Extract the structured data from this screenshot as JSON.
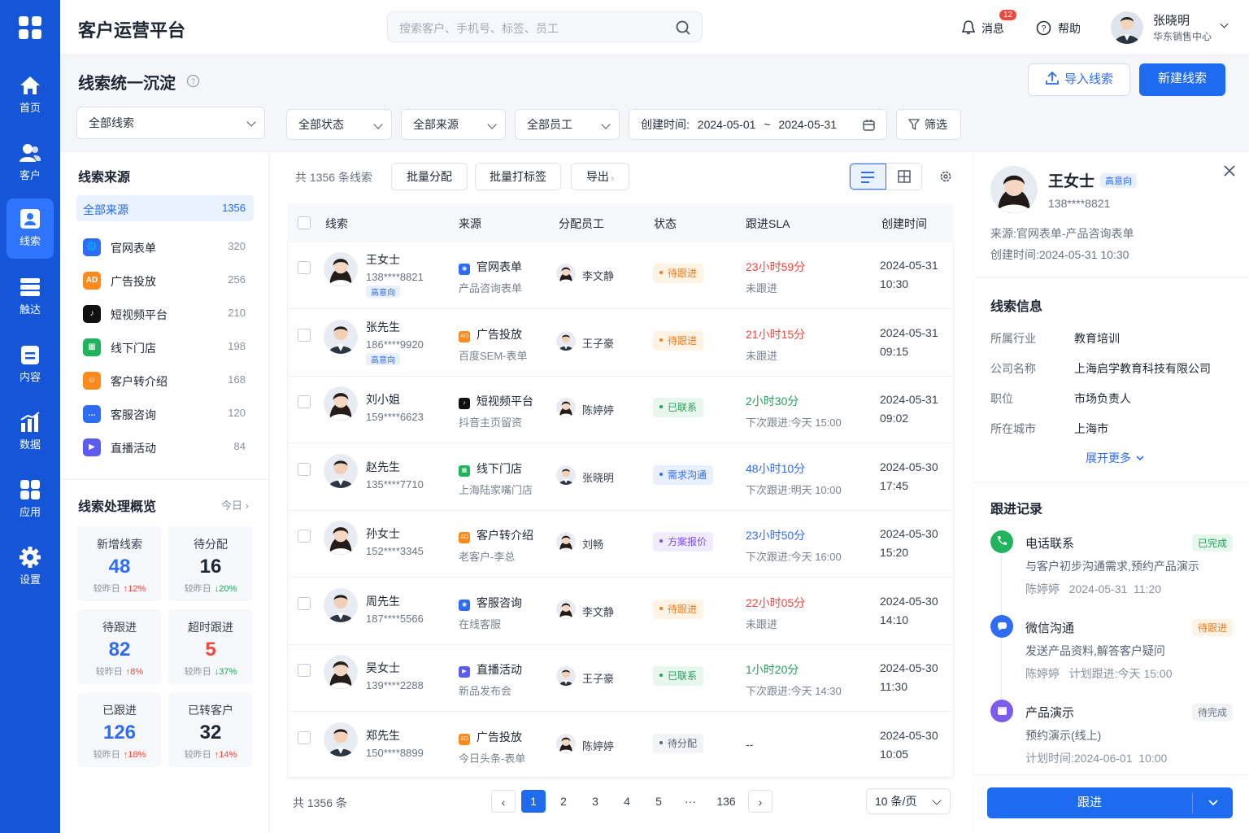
{
  "nav": {
    "items": [
      {
        "label": "首页"
      },
      {
        "label": "客户"
      },
      {
        "label": "线索"
      },
      {
        "label": "触达"
      },
      {
        "label": "内容"
      },
      {
        "label": "数据"
      },
      {
        "label": "应用"
      },
      {
        "label": "设置"
      }
    ]
  },
  "header": {
    "app_title": "客户运营平台",
    "search_placeholder": "搜索客户、手机号、标签、员工",
    "messages_label": "消息",
    "messages_count": "12",
    "help_label": "帮助",
    "user_name": "张晓明",
    "user_dept": "华东销售中心"
  },
  "page": {
    "title": "线索统一沉淀",
    "import_label": "导入线索",
    "new_label": "新建线索"
  },
  "filters": {
    "scope": "全部线索",
    "status": "全部状态",
    "source": "全部来源",
    "staff": "全部员工",
    "date_label": "创建时间:",
    "date_start": "2024-05-01",
    "date_sep": "~",
    "date_end": "2024-05-31",
    "filter_label": "筛选"
  },
  "sources": {
    "title": "线索来源",
    "all_label": "全部来源",
    "all_count": "1356",
    "items": [
      {
        "label": "官网表单",
        "count": "320",
        "icon": "globe-icon",
        "color": "#2f6cf5"
      },
      {
        "label": "广告投放",
        "count": "256",
        "icon": "ad-icon",
        "color": "#ff8a1f"
      },
      {
        "label": "短视频平台",
        "count": "210",
        "icon": "tiktok-icon",
        "color": "#111111"
      },
      {
        "label": "线下门店",
        "count": "198",
        "icon": "store-icon",
        "color": "#22b35e"
      },
      {
        "label": "客户转介绍",
        "count": "168",
        "icon": "referral-icon",
        "color": "#ff8a1f"
      },
      {
        "label": "客服咨询",
        "count": "120",
        "icon": "chat-icon",
        "color": "#2f6cf5"
      },
      {
        "label": "直播活动",
        "count": "84",
        "icon": "live-icon",
        "color": "#5b5bf0"
      }
    ]
  },
  "overview": {
    "title": "线索处理概览",
    "period": "今日",
    "cards": [
      {
        "title": "新增线索",
        "value": "48",
        "prefix": "较昨日",
        "change": "↑12%",
        "value_color": "#2f6cf5",
        "change_color": "#f0483e"
      },
      {
        "title": "待分配",
        "value": "16",
        "prefix": "较昨日",
        "change": "↓20%",
        "value_color": "#1f2633",
        "change_color": "#22a05a"
      },
      {
        "title": "待跟进",
        "value": "82",
        "prefix": "较昨日",
        "change": "↑8%",
        "value_color": "#2f6cf5",
        "change_color": "#f0483e"
      },
      {
        "title": "超时跟进",
        "value": "5",
        "prefix": "较昨日",
        "change": "↓37%",
        "value_color": "#f0483e",
        "change_color": "#22a05a"
      },
      {
        "title": "已跟进",
        "value": "126",
        "prefix": "较昨日",
        "change": "↑18%",
        "value_color": "#2f6cf5",
        "change_color": "#f0483e"
      },
      {
        "title": "已转客户",
        "value": "32",
        "prefix": "较昨日",
        "change": "↑14%",
        "value_color": "#1f2633",
        "change_color": "#f0483e"
      }
    ]
  },
  "table": {
    "total_label": "共 1356 条线索",
    "batch_assign": "批量分配",
    "batch_tag": "批量打标签",
    "export_label": "导出",
    "columns": [
      "线索",
      "来源",
      "分配员工",
      "状态",
      "跟进SLA",
      "创建时间"
    ],
    "rows": [
      {
        "name": "王女士",
        "phone": "138****8821",
        "badge": "高意向",
        "gender": "f",
        "src": "官网表单",
        "src_sub": "产品咨询表单",
        "src_color": "#2f6cf5",
        "staff": "李文静",
        "status": "待跟进",
        "status_type": "orange",
        "sla": "23小时59分",
        "sla_sub": "未跟进",
        "sla_color": "#f0483e",
        "date": "2024-05-31",
        "time": "10:30"
      },
      {
        "name": "张先生",
        "phone": "186****9920",
        "badge": "高意向",
        "gender": "m",
        "src": "广告投放",
        "src_sub": "百度SEM-表单",
        "src_color": "#ff8a1f",
        "staff": "王子豪",
        "status": "待跟进",
        "status_type": "orange",
        "sla": "21小时15分",
        "sla_sub": "未跟进",
        "sla_color": "#f0483e",
        "date": "2024-05-31",
        "time": "09:15"
      },
      {
        "name": "刘小姐",
        "phone": "159****6623",
        "badge": "",
        "gender": "f",
        "src": "短视频平台",
        "src_sub": "抖音主页留资",
        "src_color": "#111111",
        "staff": "陈婷婷",
        "status": "已联系",
        "status_type": "green",
        "sla": "2小时30分",
        "sla_sub": "下次跟进:今天 15:00",
        "sla_color": "#22a05a",
        "date": "2024-05-31",
        "time": "09:02"
      },
      {
        "name": "赵先生",
        "phone": "135****7710",
        "badge": "",
        "gender": "m",
        "src": "线下门店",
        "src_sub": "上海陆家嘴门店",
        "src_color": "#22b35e",
        "staff": "张晓明",
        "status": "需求沟通",
        "status_type": "blue",
        "sla": "48小时10分",
        "sla_sub": "下次跟进:明天 10:00",
        "sla_color": "#2f6cf5",
        "date": "2024-05-30",
        "time": "17:45"
      },
      {
        "name": "孙女士",
        "phone": "152****3345",
        "badge": "",
        "gender": "f",
        "src": "客户转介绍",
        "src_sub": "老客户-李总",
        "src_color": "#ff8a1f",
        "staff": "刘畅",
        "status": "方案报价",
        "status_type": "purple",
        "sla": "23小时50分",
        "sla_sub": "下次跟进:今天 16:00",
        "sla_color": "#2f6cf5",
        "date": "2024-05-30",
        "time": "15:20"
      },
      {
        "name": "周先生",
        "phone": "187****5566",
        "badge": "",
        "gender": "m",
        "src": "客服咨询",
        "src_sub": "在线客服",
        "src_color": "#2f6cf5",
        "staff": "李文静",
        "status": "待跟进",
        "status_type": "orange",
        "sla": "22小时05分",
        "sla_sub": "未跟进",
        "sla_color": "#f0483e",
        "date": "2024-05-30",
        "time": "14:10"
      },
      {
        "name": "吴女士",
        "phone": "139****2288",
        "badge": "",
        "gender": "f",
        "src": "直播活动",
        "src_sub": "新品发布会",
        "src_color": "#5b5bf0",
        "staff": "王子豪",
        "status": "已联系",
        "status_type": "green",
        "sla": "1小时20分",
        "sla_sub": "下次跟进:今天 14:30",
        "sla_color": "#22a05a",
        "date": "2024-05-30",
        "time": "11:30"
      },
      {
        "name": "郑先生",
        "phone": "150****8899",
        "badge": "",
        "gender": "m",
        "src": "广告投放",
        "src_sub": "今日头条-表单",
        "src_color": "#ff8a1f",
        "staff": "陈婷婷",
        "status": "待分配",
        "status_type": "gray",
        "sla": "--",
        "sla_sub": "",
        "sla_color": "#3a4150",
        "date": "2024-05-30",
        "time": "10:05"
      }
    ]
  },
  "pagination": {
    "total": "共 1356 条",
    "pages": [
      "1",
      "2",
      "3",
      "4",
      "5",
      "···",
      "136"
    ],
    "page_size": "10 条/页"
  },
  "detail": {
    "name": "王女士",
    "badge": "高意向",
    "phone": "138****8821",
    "source": "来源:官网表单-产品咨询表单",
    "created": "创建时间:2024-05-31 10:30",
    "info_title": "线索信息",
    "info": [
      {
        "label": "所属行业",
        "value": "教育培训"
      },
      {
        "label": "公司名称",
        "value": "上海启学教育科技有限公司"
      },
      {
        "label": "职位",
        "value": "市场负责人"
      },
      {
        "label": "所在城市",
        "value": "上海市"
      }
    ],
    "expand": "展开更多",
    "records_title": "跟进记录",
    "records": [
      {
        "title": "电话联系",
        "tag": "已完成",
        "desc": "与客户初步沟通需求,预约产品演示",
        "meta": "陈婷婷   2024-05-31  11:20",
        "color": "#22b35e",
        "tag_bg": "#e8f7ee",
        "tag_color": "#22a05a",
        "icon": "phone-icon"
      },
      {
        "title": "微信沟通",
        "tag": "待跟进",
        "desc": "发送产品资料,解答客户疑问",
        "meta": "陈婷婷   计划跟进:今天 15:00",
        "color": "#2f6cf5",
        "tag_bg": "#fff3e6",
        "tag_color": "#f07b1a",
        "icon": "wechat-icon"
      },
      {
        "title": "产品演示",
        "tag": "待完成",
        "desc": "预约演示(线上)",
        "meta": "计划时间:2024-06-01  10:00",
        "color": "#7b5cf0",
        "tag_bg": "#f2f3f6",
        "tag_color": "#6b7382",
        "icon": "calendar-icon"
      }
    ],
    "follow_btn": "跟进"
  }
}
